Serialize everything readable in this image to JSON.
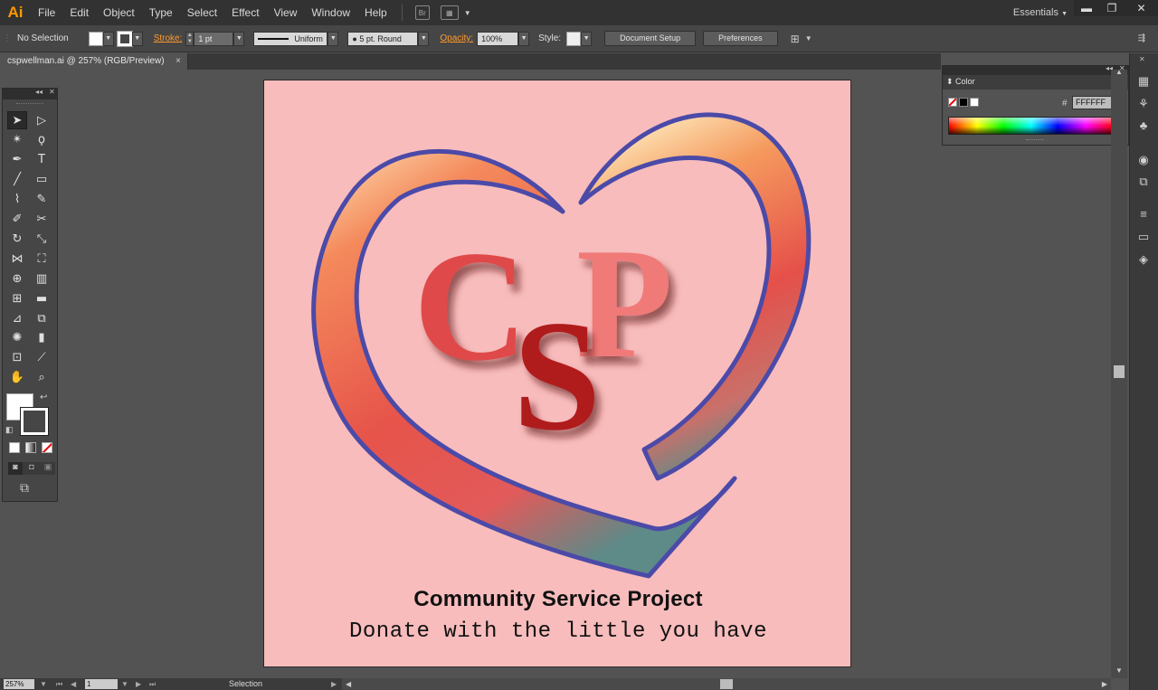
{
  "app": {
    "logo": "Ai",
    "menu": [
      "File",
      "Edit",
      "Object",
      "Type",
      "Select",
      "Effect",
      "View",
      "Window",
      "Help"
    ],
    "bridge_icon": "Br",
    "workspace": "Essentials"
  },
  "window_controls": {
    "minimize": "▬",
    "restore": "❐",
    "close": "✕"
  },
  "control_bar": {
    "selection_status": "No Selection",
    "stroke_label": "Stroke:",
    "stroke_weight": "1 pt",
    "stroke_profile": "Uniform",
    "brush": "5 pt. Round",
    "opacity_label": "Opacity:",
    "opacity": "100%",
    "style_label": "Style:",
    "document_setup": "Document Setup",
    "preferences": "Preferences"
  },
  "document": {
    "tab_title": "cspwellman.ai @ 257% (RGB/Preview)",
    "close": "×"
  },
  "artwork": {
    "letters": [
      "C",
      "S",
      "P"
    ],
    "tagline_title": "Community Service Project",
    "tagline_subtitle": "Donate with the little you have",
    "colors": {
      "artboard": "#f8bcbc",
      "heart_outline": "#4b4aa8",
      "c_letter": "#e04a48",
      "s_letter": "#b01c1c",
      "p_letter": "#f07a78"
    }
  },
  "color_panel": {
    "title": "Color",
    "hex_label": "#",
    "hex_value": "FFFFFF"
  },
  "status_bar": {
    "zoom": "257%",
    "page": "1",
    "status": "Selection"
  },
  "tools": [
    "selection",
    "direct-selection",
    "magic-wand",
    "lasso",
    "pen",
    "type",
    "line-segment",
    "rectangle",
    "paintbrush",
    "pencil",
    "blob-brush",
    "eraser",
    "rotate",
    "scale",
    "width",
    "free-transform",
    "shape-builder",
    "perspective-grid",
    "mesh",
    "gradient",
    "eyedropper",
    "blend",
    "symbol-sprayer",
    "column-graph",
    "artboard",
    "slice",
    "hand",
    "zoom"
  ]
}
